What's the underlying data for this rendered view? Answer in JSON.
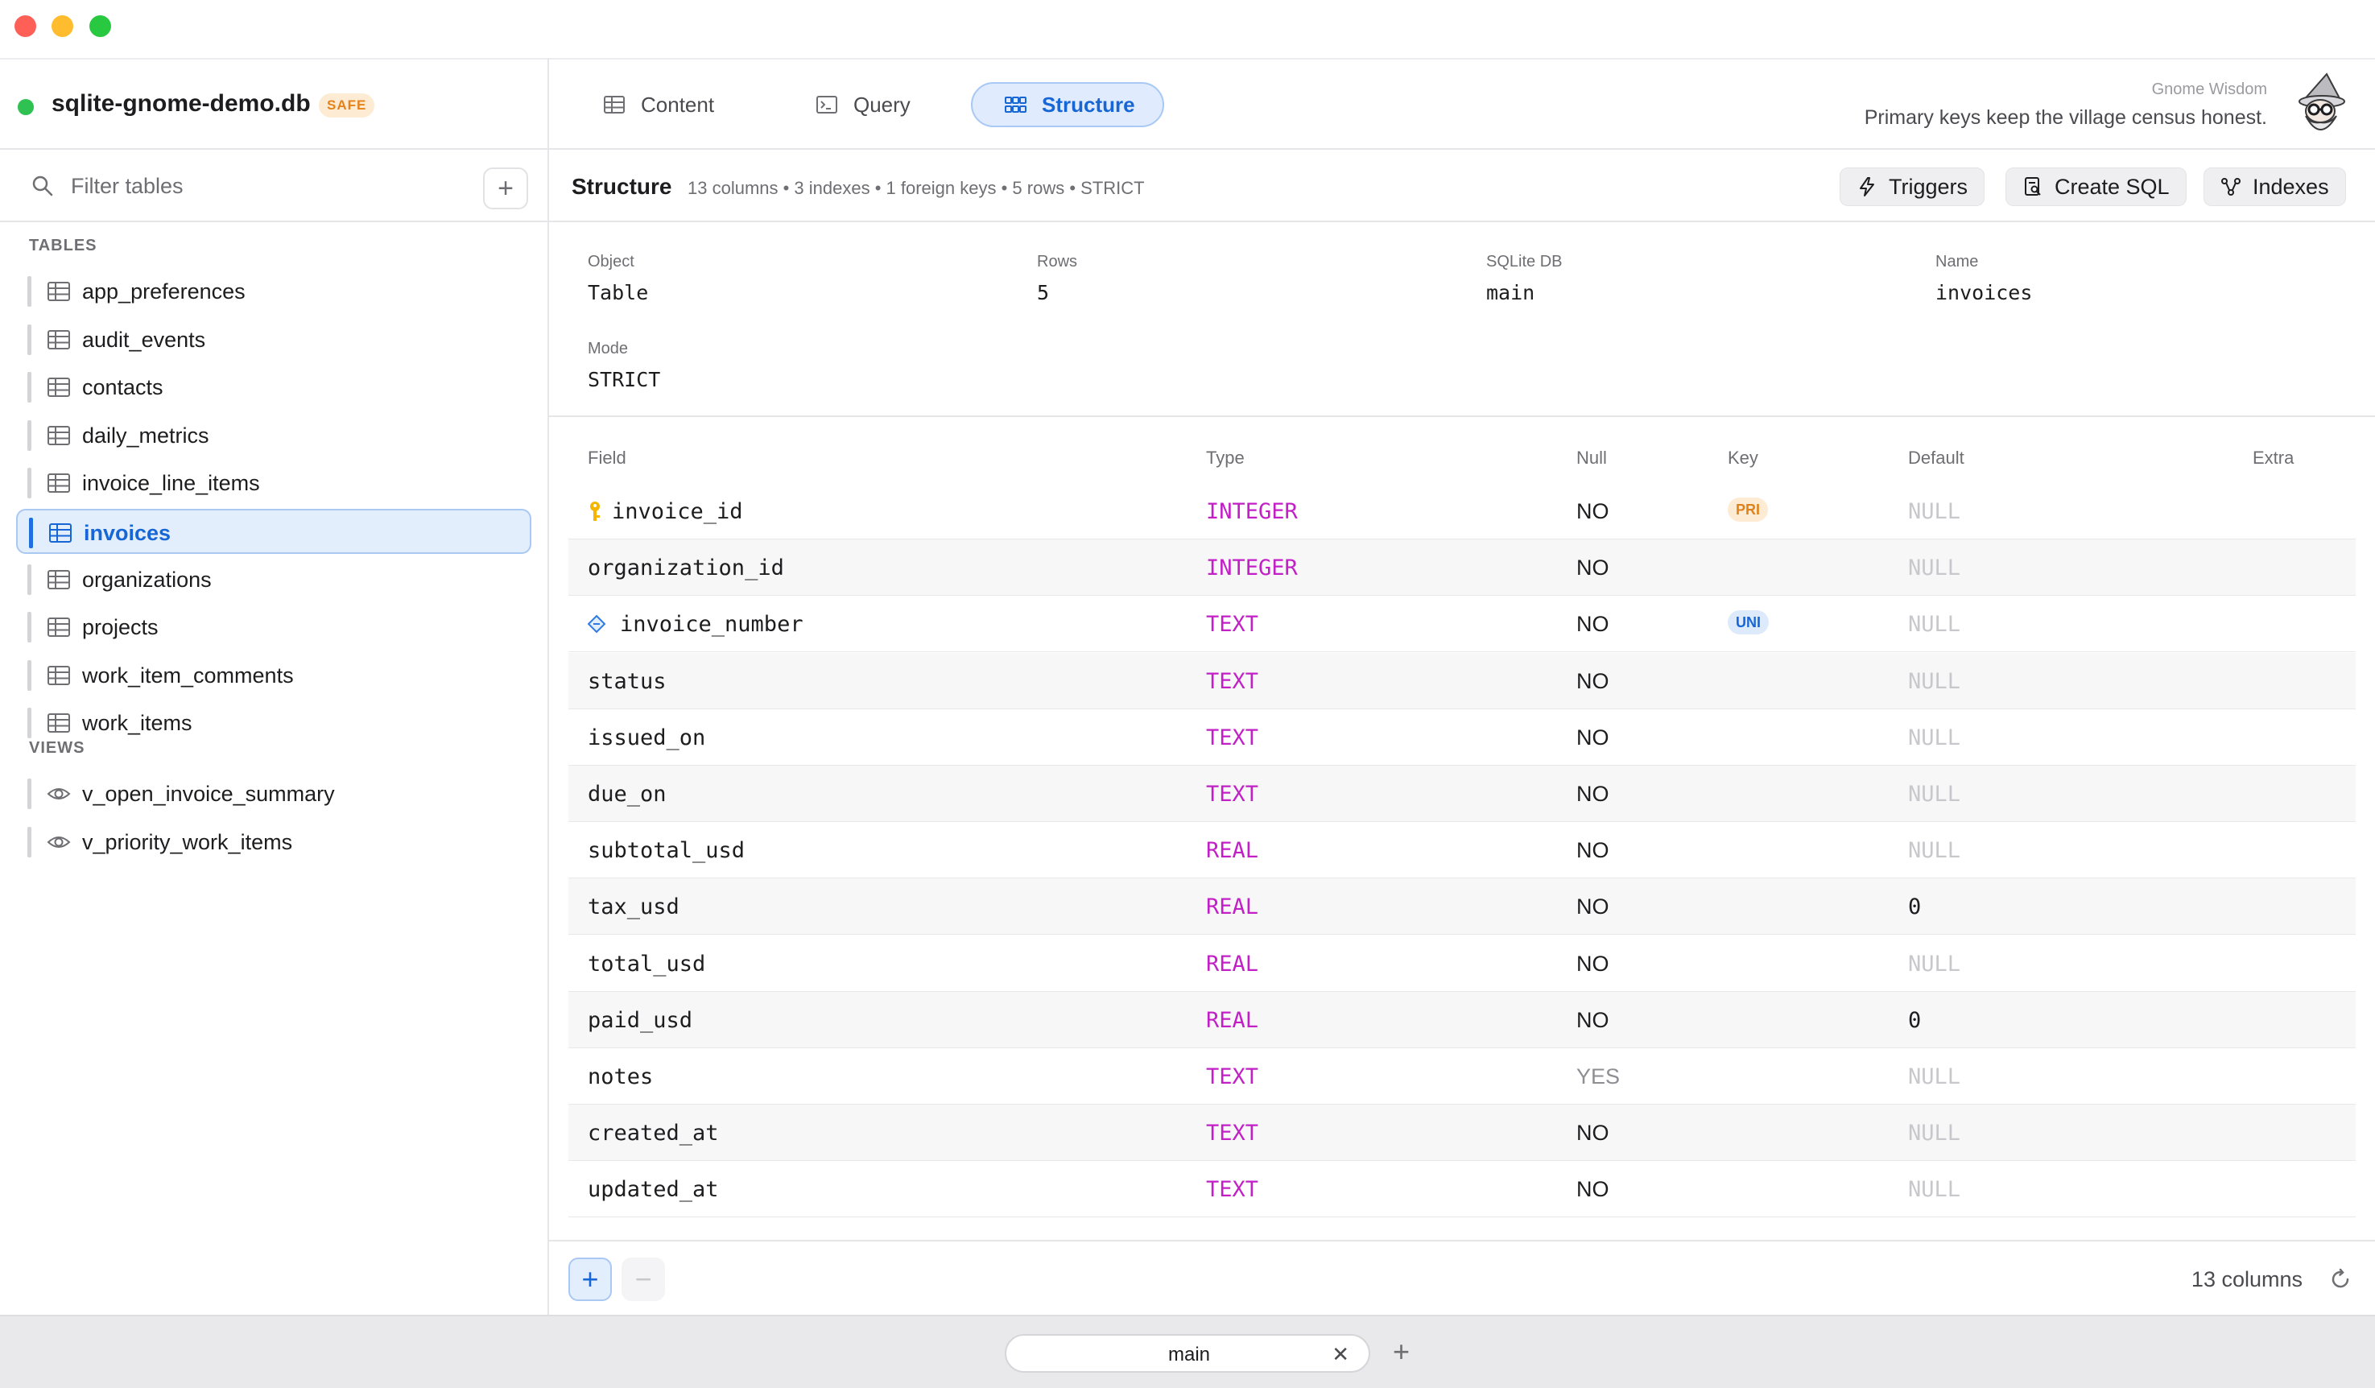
{
  "window": {
    "controls": [
      "close",
      "minimize",
      "zoom"
    ]
  },
  "database": {
    "name": "sqlite-gnome-demo.db",
    "badge": "SAFE",
    "status_color": "#2fc152"
  },
  "sidebar": {
    "filter_placeholder": "Filter tables",
    "add_label": "+",
    "tables_label": "TABLES",
    "tables": [
      "app_preferences",
      "audit_events",
      "contacts",
      "daily_metrics",
      "invoice_line_items",
      "invoices",
      "organizations",
      "projects",
      "work_item_comments",
      "work_items"
    ],
    "active_table": "invoices",
    "views_label": "VIEWS",
    "views": [
      "v_open_invoice_summary",
      "v_priority_work_items"
    ]
  },
  "tabs": [
    {
      "label": "Content",
      "icon": "table-icon"
    },
    {
      "label": "Query",
      "icon": "terminal-icon"
    },
    {
      "label": "Structure",
      "icon": "grid-icon",
      "active": true
    }
  ],
  "wisdom": {
    "title": "Gnome Wisdom",
    "text": "Primary keys keep the village census honest."
  },
  "toolbar": {
    "title": "Structure",
    "meta": "13 columns • 3 indexes • 1 foreign keys • 5 rows • STRICT",
    "buttons": {
      "triggers": "Triggers",
      "create_sql": "Create SQL",
      "indexes": "Indexes"
    }
  },
  "info": {
    "object": {
      "label": "Object",
      "value": "Table"
    },
    "rows": {
      "label": "Rows",
      "value": "5"
    },
    "db": {
      "label": "SQLite DB",
      "value": "main"
    },
    "name": {
      "label": "Name",
      "value": "invoices"
    },
    "mode": {
      "label": "Mode",
      "value": "STRICT"
    }
  },
  "columns_header": {
    "field": "Field",
    "type": "Type",
    "null": "Null",
    "key": "Key",
    "default": "Default",
    "extra": "Extra"
  },
  "columns": [
    {
      "field": "invoice_id",
      "type": "INTEGER",
      "null": "NO",
      "key": "PRI",
      "default": "NULL"
    },
    {
      "field": "organization_id",
      "type": "INTEGER",
      "null": "NO",
      "key": "",
      "default": "NULL"
    },
    {
      "field": "invoice_number",
      "type": "TEXT",
      "null": "NO",
      "key": "UNI",
      "default": "NULL"
    },
    {
      "field": "status",
      "type": "TEXT",
      "null": "NO",
      "key": "",
      "default": "NULL"
    },
    {
      "field": "issued_on",
      "type": "TEXT",
      "null": "NO",
      "key": "",
      "default": "NULL"
    },
    {
      "field": "due_on",
      "type": "TEXT",
      "null": "NO",
      "key": "",
      "default": "NULL"
    },
    {
      "field": "subtotal_usd",
      "type": "REAL",
      "null": "NO",
      "key": "",
      "default": "NULL"
    },
    {
      "field": "tax_usd",
      "type": "REAL",
      "null": "NO",
      "key": "",
      "default": "0"
    },
    {
      "field": "total_usd",
      "type": "REAL",
      "null": "NO",
      "key": "",
      "default": "NULL"
    },
    {
      "field": "paid_usd",
      "type": "REAL",
      "null": "NO",
      "key": "",
      "default": "0"
    },
    {
      "field": "notes",
      "type": "TEXT",
      "null": "YES",
      "key": "",
      "default": "NULL"
    },
    {
      "field": "created_at",
      "type": "TEXT",
      "null": "NO",
      "key": "",
      "default": "NULL"
    },
    {
      "field": "updated_at",
      "type": "TEXT",
      "null": "NO",
      "key": "",
      "default": "NULL"
    }
  ],
  "footer": {
    "add": "+",
    "remove": "−",
    "count": "13 columns"
  },
  "workspace": {
    "tab": "main",
    "close": "✕",
    "add": "+"
  }
}
